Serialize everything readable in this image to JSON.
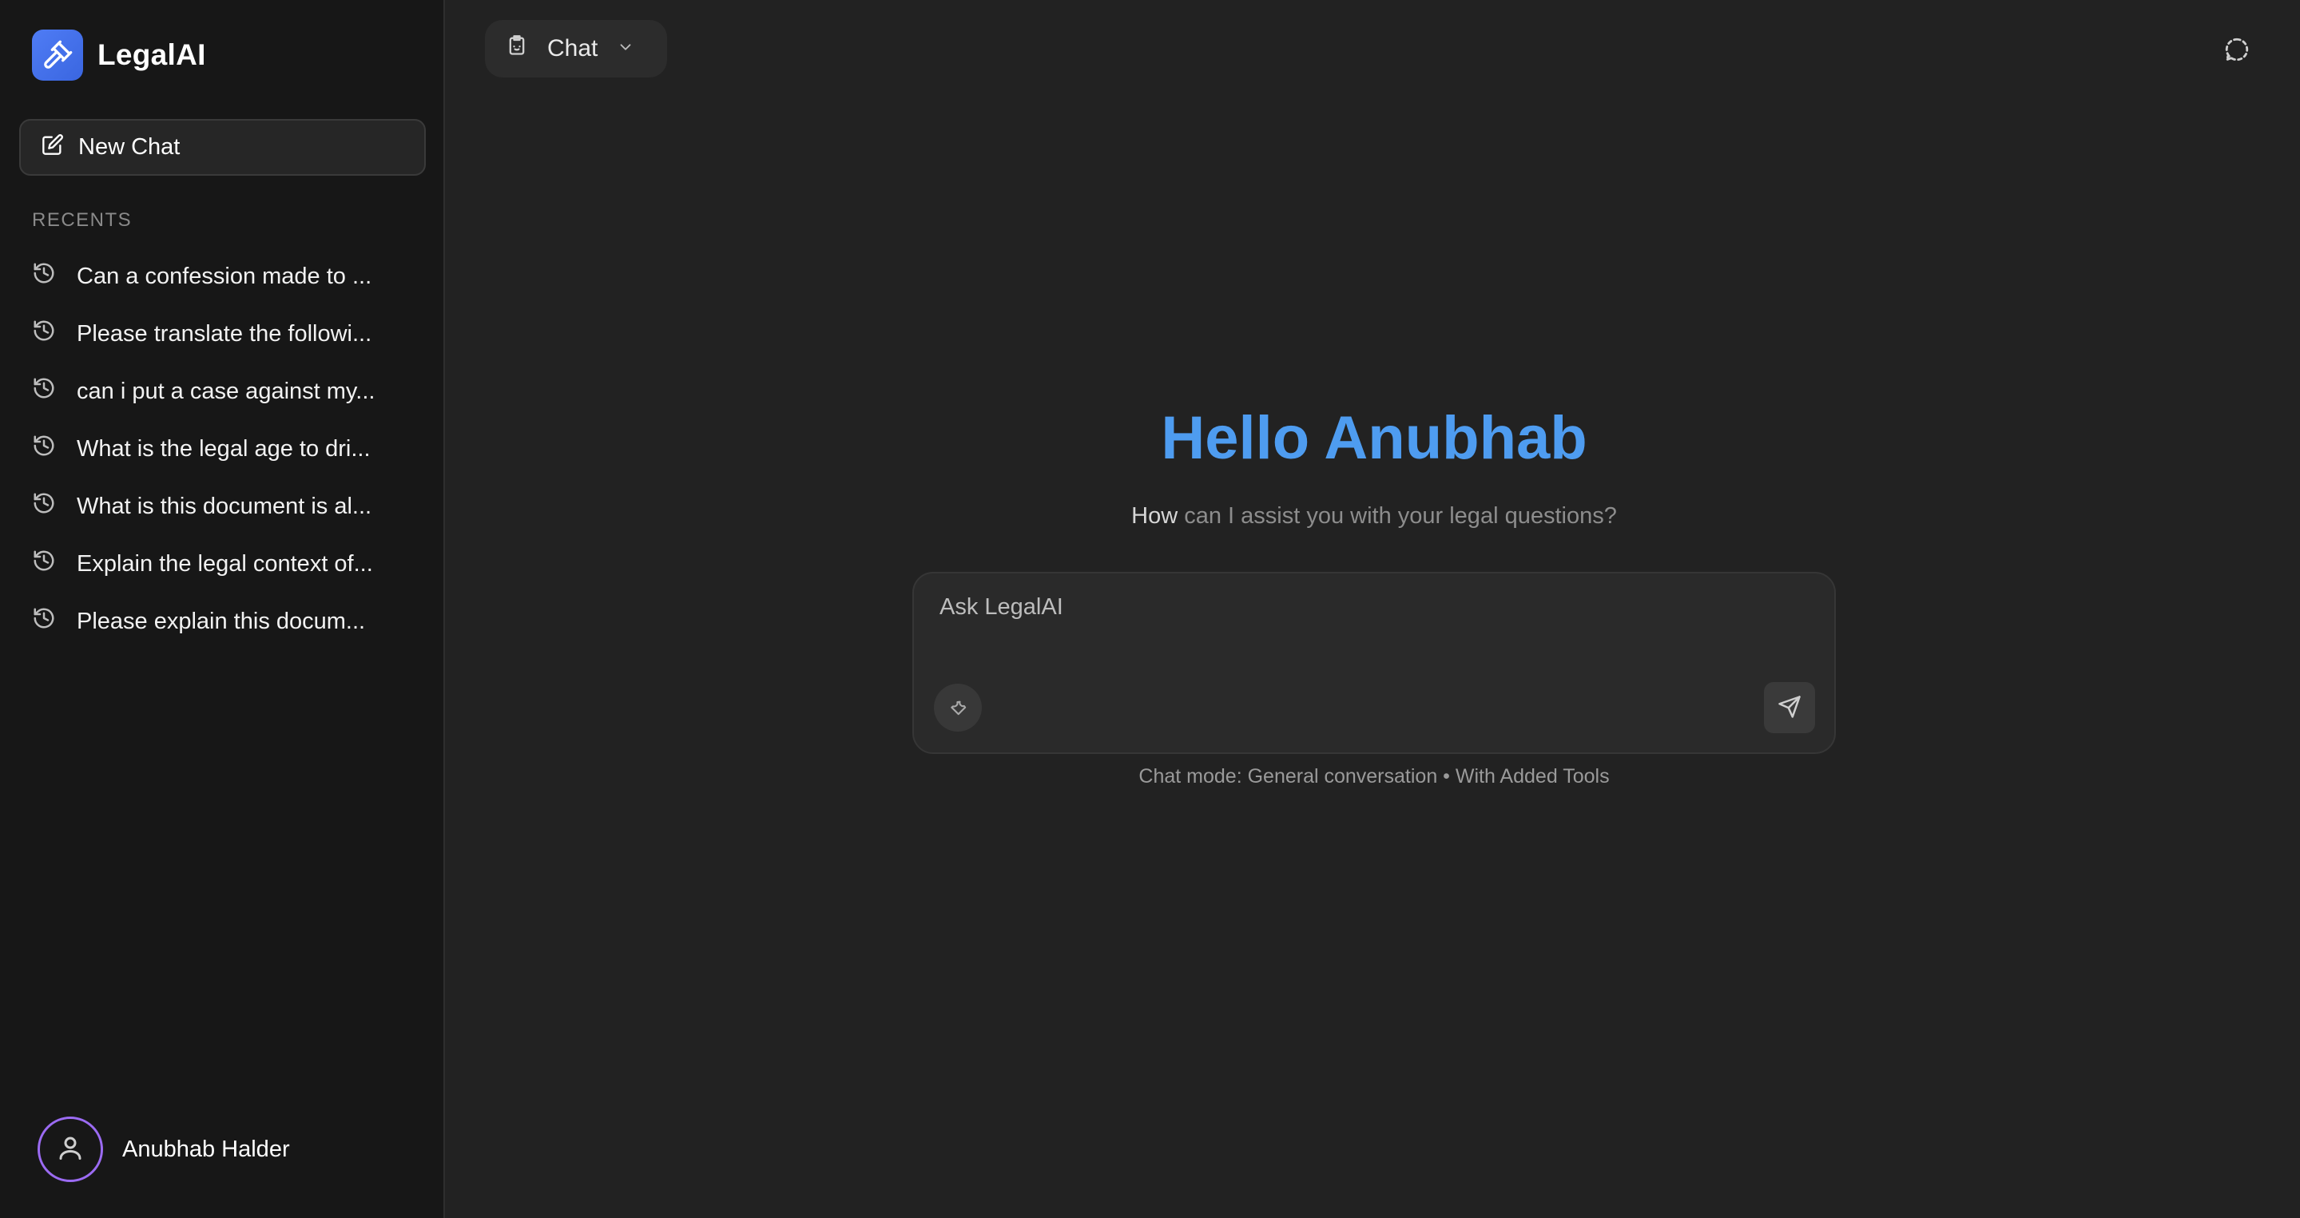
{
  "brand": {
    "name": "LegalAI"
  },
  "sidebar": {
    "new_chat_label": "New Chat",
    "recents_label": "RECENTS",
    "recents": [
      "Can a confession made to ...",
      "Please translate the followi...",
      "can i put a case against my...",
      "What is the legal age to dri...",
      "What is this document is al...",
      "Explain the legal context of...",
      "Please explain this docum..."
    ],
    "user_name": "Anubhab Halder"
  },
  "header": {
    "mode_label": "Chat"
  },
  "main": {
    "greeting": "Hello Anubhab",
    "subtitle_first": "How",
    "subtitle_rest": " can I assist you with your legal questions?",
    "input_placeholder": "Ask LegalAI",
    "mode_caption": "Chat mode: General conversation • With Added Tools"
  },
  "icons": {
    "brand": "gavel-icon",
    "new_chat": "edit-icon",
    "recent": "history-icon",
    "avatar": "user-icon",
    "mode": "clipboard-icon",
    "mode_caret": "chevron-down-icon",
    "top_right": "chat-bubble-dashed-icon",
    "tools": "wrench-icon",
    "send": "send-icon"
  },
  "colors": {
    "accent": "#4e9cf0",
    "brand": "#4f7cf5",
    "avatar_ring": "#9b6bf2",
    "background": "#222222",
    "sidebar": "#171717"
  }
}
